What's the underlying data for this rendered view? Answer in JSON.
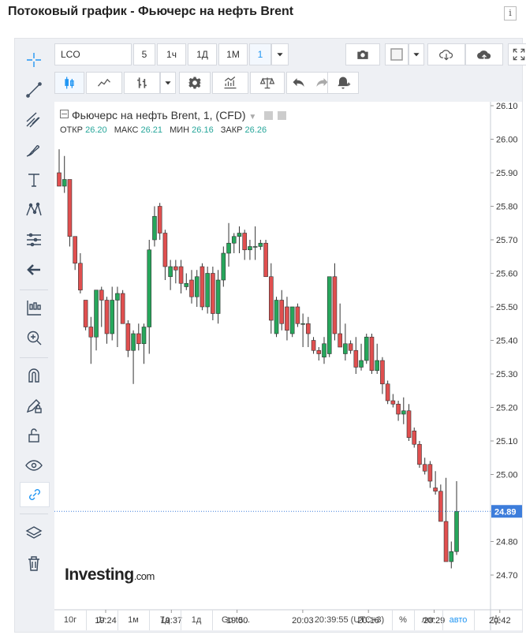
{
  "page": {
    "title": "Потоковый график - Фьючерс на нефть Brent",
    "info_icon": "info-icon"
  },
  "toolbar": {
    "symbol": "LCO",
    "intervals": [
      "5",
      "1ч",
      "1Д",
      "1М",
      "1"
    ],
    "selected_interval": "1",
    "icons": [
      "camera-icon",
      "color-square-icon",
      "cloud-download-icon",
      "cloud-upload-icon",
      "fullscreen-icon"
    ]
  },
  "toolbar2": {
    "icons": [
      "candles-icon",
      "line-chart-icon",
      "bars-icon",
      "chevron-down-icon",
      "gear-icon",
      "indicators-icon",
      "compare-icon",
      "undo-icon",
      "redo-icon",
      "alert-icon"
    ]
  },
  "leftbar": {
    "icons": [
      "crosshair-icon",
      "trend-line-icon",
      "pitchfork-icon",
      "brush-icon",
      "text-icon",
      "pattern-icon",
      "fib-icon",
      "arrow-left-icon",
      "candle-builder-icon",
      "zoom-in-icon",
      "magnet-icon",
      "lock-pencil-icon",
      "unlock-icon",
      "eye-icon",
      "link-icon",
      "layers-icon",
      "trash-icon"
    ]
  },
  "legend": {
    "title": "Фьючерс на нефть Brent, 1, (CFD)",
    "open_label": "ОТКР",
    "open": "26.20",
    "high_label": "МАКС",
    "high": "26.21",
    "low_label": "МИН",
    "low": "26.16",
    "close_label": "ЗАКР",
    "close": "26.26"
  },
  "logo": {
    "main": "Investing",
    "suffix": ".com"
  },
  "bottombar": {
    "ranges": [
      "10г",
      "1г",
      "1м",
      "7д",
      "1д"
    ],
    "goto": "Go to...",
    "clock": "20:39:55 (UTC+3)",
    "percent": "%",
    "log": "лог",
    "auto": "авто",
    "settings_icon": "gear-icon"
  },
  "colors": {
    "up": "#26a65b",
    "down": "#e04f4f",
    "accent": "#2196f3",
    "last_price_label": "#3d7ddb"
  },
  "chart_data": {
    "type": "candlestick",
    "title": "Фьючерс на нефть Brent, 1, (CFD)",
    "ylim": [
      24.68,
      26.12
    ],
    "y_ticks": [
      "26.10",
      "26.00",
      "25.90",
      "25.80",
      "25.70",
      "25.60",
      "25.50",
      "25.40",
      "25.30",
      "25.20",
      "25.10",
      "25.00",
      "24.80",
      "24.70"
    ],
    "x_ticks": [
      "19:24",
      "19:37",
      "19:50",
      "20:03",
      "20:16",
      "20:29",
      "20:42"
    ],
    "last_price": "24.89",
    "candles": [
      {
        "o": 25.9,
        "h": 25.97,
        "l": 25.86,
        "c": 25.86
      },
      {
        "o": 25.86,
        "h": 25.95,
        "l": 25.84,
        "c": 25.88
      },
      {
        "o": 25.88,
        "h": 25.88,
        "l": 25.68,
        "c": 25.71
      },
      {
        "o": 25.71,
        "h": 25.71,
        "l": 25.61,
        "c": 25.63
      },
      {
        "o": 25.63,
        "h": 25.66,
        "l": 25.54,
        "c": 25.55
      },
      {
        "o": 25.52,
        "h": 25.52,
        "l": 25.43,
        "c": 25.44
      },
      {
        "o": 25.44,
        "h": 25.47,
        "l": 25.33,
        "c": 25.41
      },
      {
        "o": 25.41,
        "h": 25.55,
        "l": 25.37,
        "c": 25.55
      },
      {
        "o": 25.55,
        "h": 25.56,
        "l": 25.44,
        "c": 25.52
      },
      {
        "o": 25.52,
        "h": 25.53,
        "l": 25.39,
        "c": 25.42
      },
      {
        "o": 25.42,
        "h": 25.56,
        "l": 25.4,
        "c": 25.52
      },
      {
        "o": 25.52,
        "h": 25.56,
        "l": 25.38,
        "c": 25.54
      },
      {
        "o": 25.54,
        "h": 25.55,
        "l": 25.45,
        "c": 25.45
      },
      {
        "o": 25.45,
        "h": 25.46,
        "l": 25.35,
        "c": 25.37
      },
      {
        "o": 25.37,
        "h": 25.43,
        "l": 25.27,
        "c": 25.42
      },
      {
        "o": 25.42,
        "h": 25.45,
        "l": 25.37,
        "c": 25.39
      },
      {
        "o": 25.39,
        "h": 25.45,
        "l": 25.33,
        "c": 25.44
      },
      {
        "o": 25.44,
        "h": 25.7,
        "l": 25.36,
        "c": 25.67
      },
      {
        "o": 25.7,
        "h": 25.8,
        "l": 25.68,
        "c": 25.77
      },
      {
        "o": 25.8,
        "h": 25.81,
        "l": 25.7,
        "c": 25.72
      },
      {
        "o": 25.72,
        "h": 25.73,
        "l": 25.58,
        "c": 25.62
      },
      {
        "o": 25.59,
        "h": 25.64,
        "l": 25.55,
        "c": 25.62
      },
      {
        "o": 25.62,
        "h": 25.64,
        "l": 25.57,
        "c": 25.61
      },
      {
        "o": 25.62,
        "h": 25.64,
        "l": 25.54,
        "c": 25.57
      },
      {
        "o": 25.56,
        "h": 25.6,
        "l": 25.55,
        "c": 25.57
      },
      {
        "o": 25.58,
        "h": 25.61,
        "l": 25.51,
        "c": 25.53
      },
      {
        "o": 25.53,
        "h": 25.61,
        "l": 25.5,
        "c": 25.59
      },
      {
        "o": 25.62,
        "h": 25.63,
        "l": 25.49,
        "c": 25.5
      },
      {
        "o": 25.5,
        "h": 25.62,
        "l": 25.48,
        "c": 25.6
      },
      {
        "o": 25.6,
        "h": 25.62,
        "l": 25.46,
        "c": 25.48
      },
      {
        "o": 25.48,
        "h": 25.61,
        "l": 25.45,
        "c": 25.58
      },
      {
        "o": 25.58,
        "h": 25.68,
        "l": 25.56,
        "c": 25.66
      },
      {
        "o": 25.66,
        "h": 25.75,
        "l": 25.62,
        "c": 25.69
      },
      {
        "o": 25.69,
        "h": 25.72,
        "l": 25.66,
        "c": 25.71
      },
      {
        "o": 25.71,
        "h": 25.74,
        "l": 25.66,
        "c": 25.72
      },
      {
        "o": 25.72,
        "h": 25.73,
        "l": 25.64,
        "c": 25.67
      },
      {
        "o": 25.67,
        "h": 25.7,
        "l": 25.64,
        "c": 25.68
      },
      {
        "o": 25.68,
        "h": 25.74,
        "l": 25.64,
        "c": 25.68
      },
      {
        "o": 25.68,
        "h": 25.7,
        "l": 25.67,
        "c": 25.69
      },
      {
        "o": 25.69,
        "h": 25.7,
        "l": 25.59,
        "c": 25.59
      },
      {
        "o": 25.59,
        "h": 25.63,
        "l": 25.42,
        "c": 25.46
      },
      {
        "o": 25.42,
        "h": 25.53,
        "l": 25.41,
        "c": 25.52
      },
      {
        "o": 25.52,
        "h": 25.55,
        "l": 25.43,
        "c": 25.45
      },
      {
        "o": 25.5,
        "h": 25.53,
        "l": 25.4,
        "c": 25.43
      },
      {
        "o": 25.42,
        "h": 25.5,
        "l": 25.41,
        "c": 25.5
      },
      {
        "o": 25.5,
        "h": 25.51,
        "l": 25.44,
        "c": 25.45
      },
      {
        "o": 25.45,
        "h": 25.48,
        "l": 25.38,
        "c": 25.45
      },
      {
        "o": 25.45,
        "h": 25.47,
        "l": 25.38,
        "c": 25.42
      },
      {
        "o": 25.4,
        "h": 25.41,
        "l": 25.36,
        "c": 25.37
      },
      {
        "o": 25.37,
        "h": 25.38,
        "l": 25.34,
        "c": 25.36
      },
      {
        "o": 25.35,
        "h": 25.41,
        "l": 25.33,
        "c": 25.39
      },
      {
        "o": 25.36,
        "h": 25.59,
        "l": 25.35,
        "c": 25.59
      },
      {
        "o": 25.59,
        "h": 25.63,
        "l": 25.4,
        "c": 25.42
      },
      {
        "o": 25.42,
        "h": 25.51,
        "l": 25.38,
        "c": 25.38
      },
      {
        "o": 25.36,
        "h": 25.45,
        "l": 25.34,
        "c": 25.39
      },
      {
        "o": 25.39,
        "h": 25.4,
        "l": 25.36,
        "c": 25.37
      },
      {
        "o": 25.37,
        "h": 25.41,
        "l": 25.3,
        "c": 25.32
      },
      {
        "o": 25.32,
        "h": 25.39,
        "l": 25.31,
        "c": 25.34
      },
      {
        "o": 25.34,
        "h": 25.42,
        "l": 25.33,
        "c": 25.41
      },
      {
        "o": 25.41,
        "h": 25.42,
        "l": 25.3,
        "c": 25.31
      },
      {
        "o": 25.31,
        "h": 25.39,
        "l": 25.3,
        "c": 25.34
      },
      {
        "o": 25.34,
        "h": 25.35,
        "l": 25.24,
        "c": 25.27
      },
      {
        "o": 25.27,
        "h": 25.28,
        "l": 25.21,
        "c": 25.22
      },
      {
        "o": 25.22,
        "h": 25.24,
        "l": 25.2,
        "c": 25.21
      },
      {
        "o": 25.21,
        "h": 25.22,
        "l": 25.16,
        "c": 25.18
      },
      {
        "o": 25.18,
        "h": 25.23,
        "l": 25.15,
        "c": 25.19
      },
      {
        "o": 25.19,
        "h": 25.21,
        "l": 25.1,
        "c": 25.11
      },
      {
        "o": 25.13,
        "h": 25.14,
        "l": 25.08,
        "c": 25.09
      },
      {
        "o": 25.09,
        "h": 25.1,
        "l": 25.02,
        "c": 25.03
      },
      {
        "o": 25.03,
        "h": 25.05,
        "l": 25.0,
        "c": 25.01
      },
      {
        "o": 25.03,
        "h": 25.04,
        "l": 24.96,
        "c": 24.98
      },
      {
        "o": 24.96,
        "h": 25.01,
        "l": 24.94,
        "c": 24.95
      },
      {
        "o": 24.95,
        "h": 24.97,
        "l": 24.86,
        "c": 24.86
      },
      {
        "o": 24.86,
        "h": 24.99,
        "l": 24.74,
        "c": 24.74
      },
      {
        "o": 24.74,
        "h": 24.8,
        "l": 24.72,
        "c": 24.77
      },
      {
        "o": 24.77,
        "h": 24.98,
        "l": 24.76,
        "c": 24.89
      }
    ]
  }
}
